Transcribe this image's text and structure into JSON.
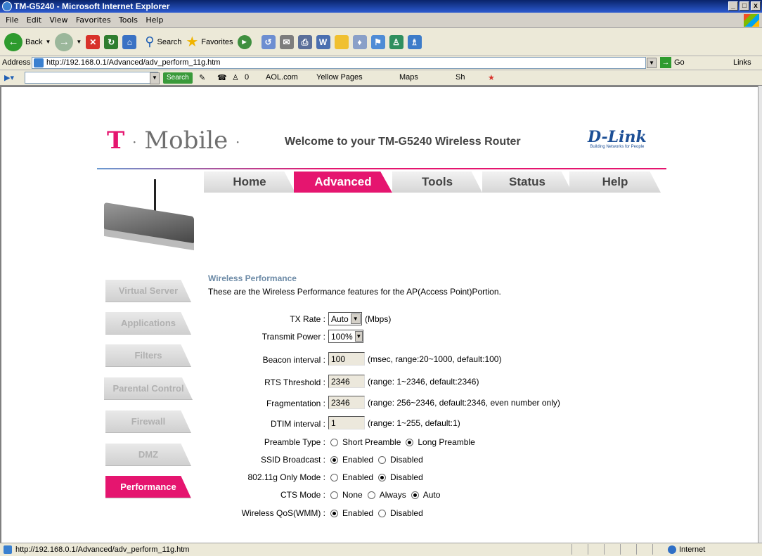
{
  "window": {
    "title": "TM-G5240 - Microsoft Internet Explorer",
    "buttons": [
      "_",
      "□",
      "x"
    ]
  },
  "menu": [
    "File",
    "Edit",
    "View",
    "Favorites",
    "Tools",
    "Help"
  ],
  "toolbar": {
    "back": "Back",
    "search": "Search",
    "favorites": "Favorites"
  },
  "address": {
    "label": "Address",
    "url": "http://192.168.0.1/Advanced/adv_perform_11g.htm",
    "go": "Go",
    "links": "Links"
  },
  "searchbar": {
    "search_btn": "Search",
    "items": [
      "0",
      "AOL.com",
      "Yellow Pages",
      "Maps",
      "Sh"
    ]
  },
  "page": {
    "brand": "Mobile",
    "brand_t": "T",
    "welcome": "Welcome to your TM-G5240 Wireless Router",
    "dlink_name": "D-Link",
    "dlink_tag": "Building Networks for People",
    "tabs": [
      "Home",
      "Advanced",
      "Tools",
      "Status",
      "Help"
    ],
    "active_tab": "Advanced",
    "side": [
      "Virtual Server",
      "Applications",
      "Filters",
      "Parental Control",
      "Firewall",
      "DMZ",
      "Performance"
    ],
    "active_side": "Performance",
    "section_title": "Wireless Performance",
    "section_desc": "These are the Wireless Performance features for the AP(Access Point)Portion.",
    "fields": {
      "tx_rate_label": "TX Rate :",
      "tx_rate_value": "Auto",
      "tx_rate_unit": "(Mbps)",
      "transmit_power_label": "Transmit Power :",
      "transmit_power_value": "100%",
      "beacon_label": "Beacon interval :",
      "beacon_value": "100",
      "beacon_hint": "(msec, range:20~1000, default:100)",
      "rts_label": "RTS Threshold :",
      "rts_value": "2346",
      "rts_hint": "(range: 1~2346, default:2346)",
      "frag_label": "Fragmentation :",
      "frag_value": "2346",
      "frag_hint": "(range: 256~2346, default:2346, even number only)",
      "dtim_label": "DTIM interval :",
      "dtim_value": "1",
      "dtim_hint": "(range: 1~255, default:1)",
      "preamble_label": "Preamble Type :",
      "preamble_short": "Short Preamble",
      "preamble_long": "Long Preamble",
      "ssid_label": "SSID Broadcast :",
      "enabled": "Enabled",
      "disabled": "Disabled",
      "g_only_label": "802.11g Only Mode :",
      "cts_label": "CTS Mode :",
      "cts_none": "None",
      "cts_always": "Always",
      "cts_auto": "Auto",
      "qos_label": "Wireless QoS(WMM) :"
    }
  },
  "status": {
    "text": "http://192.168.0.1/Advanced/adv_perform_11g.htm",
    "zone": "Internet"
  }
}
